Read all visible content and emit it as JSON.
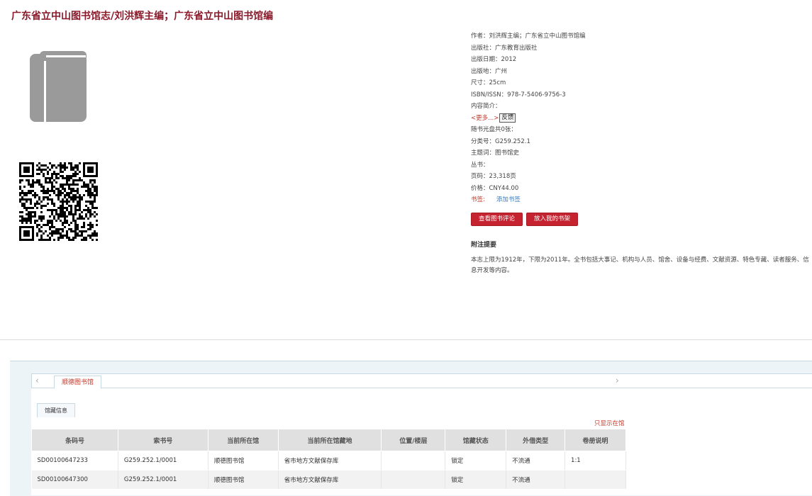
{
  "page": {
    "title": "广东省立中山图书馆志/刘洪辉主编；广东省立中山图书馆编"
  },
  "meta": {
    "author": "作者：刘洪辉主编；广东省立中山图书馆编",
    "publisher": "出版社：广东教育出版社",
    "pubdate": "出版日期：2012",
    "place": "出版地：广州",
    "size": "尺寸：25cm",
    "isbn": "ISBN/ISSN：978-7-5406-9756-3",
    "intro": "内容简介：",
    "more": "<更多...>",
    "feedback": "反馈",
    "cd": "随书光盘共0张：",
    "classno": "分类号：G259.252.1",
    "subject": "主题词：图书馆史",
    "series": "丛书：",
    "pages": "页码：23,318页",
    "price": "价格：CNY44.00",
    "bookmark_label": "书签:",
    "bookmark_add": "添加书签"
  },
  "buttons": {
    "review": "查看图书评论",
    "shelf": "放入我的书架"
  },
  "note": {
    "heading": "附注提要",
    "text": "本志上限为1912年，下限为2011年。全书包括大事记、机构与人员、馆舍、设备与经费、文献资源、特色专藏、读者服务、信息开发等内容。"
  },
  "holdings": {
    "library_tab": "顺德图书馆",
    "info_tab": "馆藏信息",
    "only_show": "只显示在馆",
    "columns": [
      "条码号",
      "索书号",
      "当前所在馆",
      "当前所在馆藏地",
      "位置/楼层",
      "馆藏状态",
      "外借类型",
      "卷册说明"
    ],
    "rows": [
      [
        "SD00100647233",
        "G259.252.1/0001",
        "顺德图书馆",
        "省市地方文献保存库",
        "",
        "锁定",
        "不流通",
        "1:1"
      ],
      [
        "SD00100647300",
        "G259.252.1/0001",
        "顺德图书馆",
        "省市地方文献保存库",
        "",
        "锁定",
        "不流通",
        ""
      ]
    ]
  },
  "icons": {
    "cover": "book-icon",
    "qr": "qr-code-icon",
    "left": "chevron-left-icon",
    "right": "chevron-right-icon"
  },
  "colors": {
    "accent": "#c4232f",
    "title": "#8b1a2b"
  }
}
